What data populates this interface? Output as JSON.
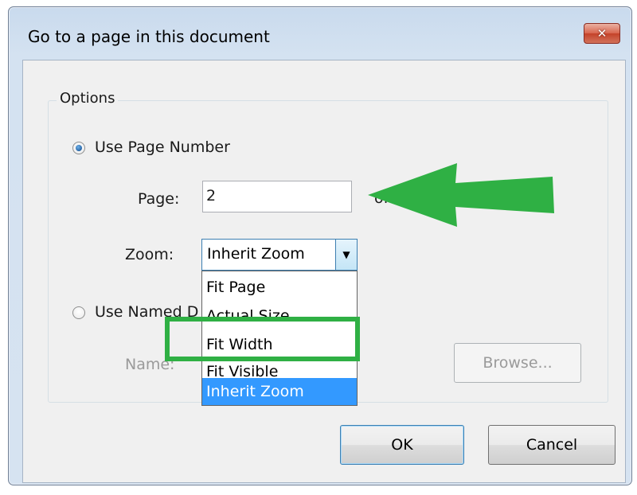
{
  "window": {
    "title": "Go to a page in this document",
    "close_glyph": "✕"
  },
  "options": {
    "legend": "Options",
    "use_page_number_label": "Use Page Number",
    "page_label": "Page:",
    "page_value": "2",
    "of_label": "of 32",
    "zoom_label": "Zoom:",
    "zoom_value": "Inherit Zoom",
    "zoom_arrow": "▼",
    "zoom_options": [
      "Fit Page",
      "Actual Size",
      "Fit Width",
      "Fit Visible",
      "Inherit Zoom"
    ],
    "zoom_selected": "Inherit Zoom",
    "use_named_label": "Use Named D",
    "name_label": "Name:",
    "browse_label": "Browse..."
  },
  "buttons": {
    "ok_label": "OK",
    "cancel_label": "Cancel"
  },
  "colors": {
    "annotation": "#2fb044",
    "selection": "#3399ff"
  },
  "icons": {
    "close": "close-icon",
    "arrow": "annotation-arrow",
    "dropdown": "chevron-down-icon"
  }
}
